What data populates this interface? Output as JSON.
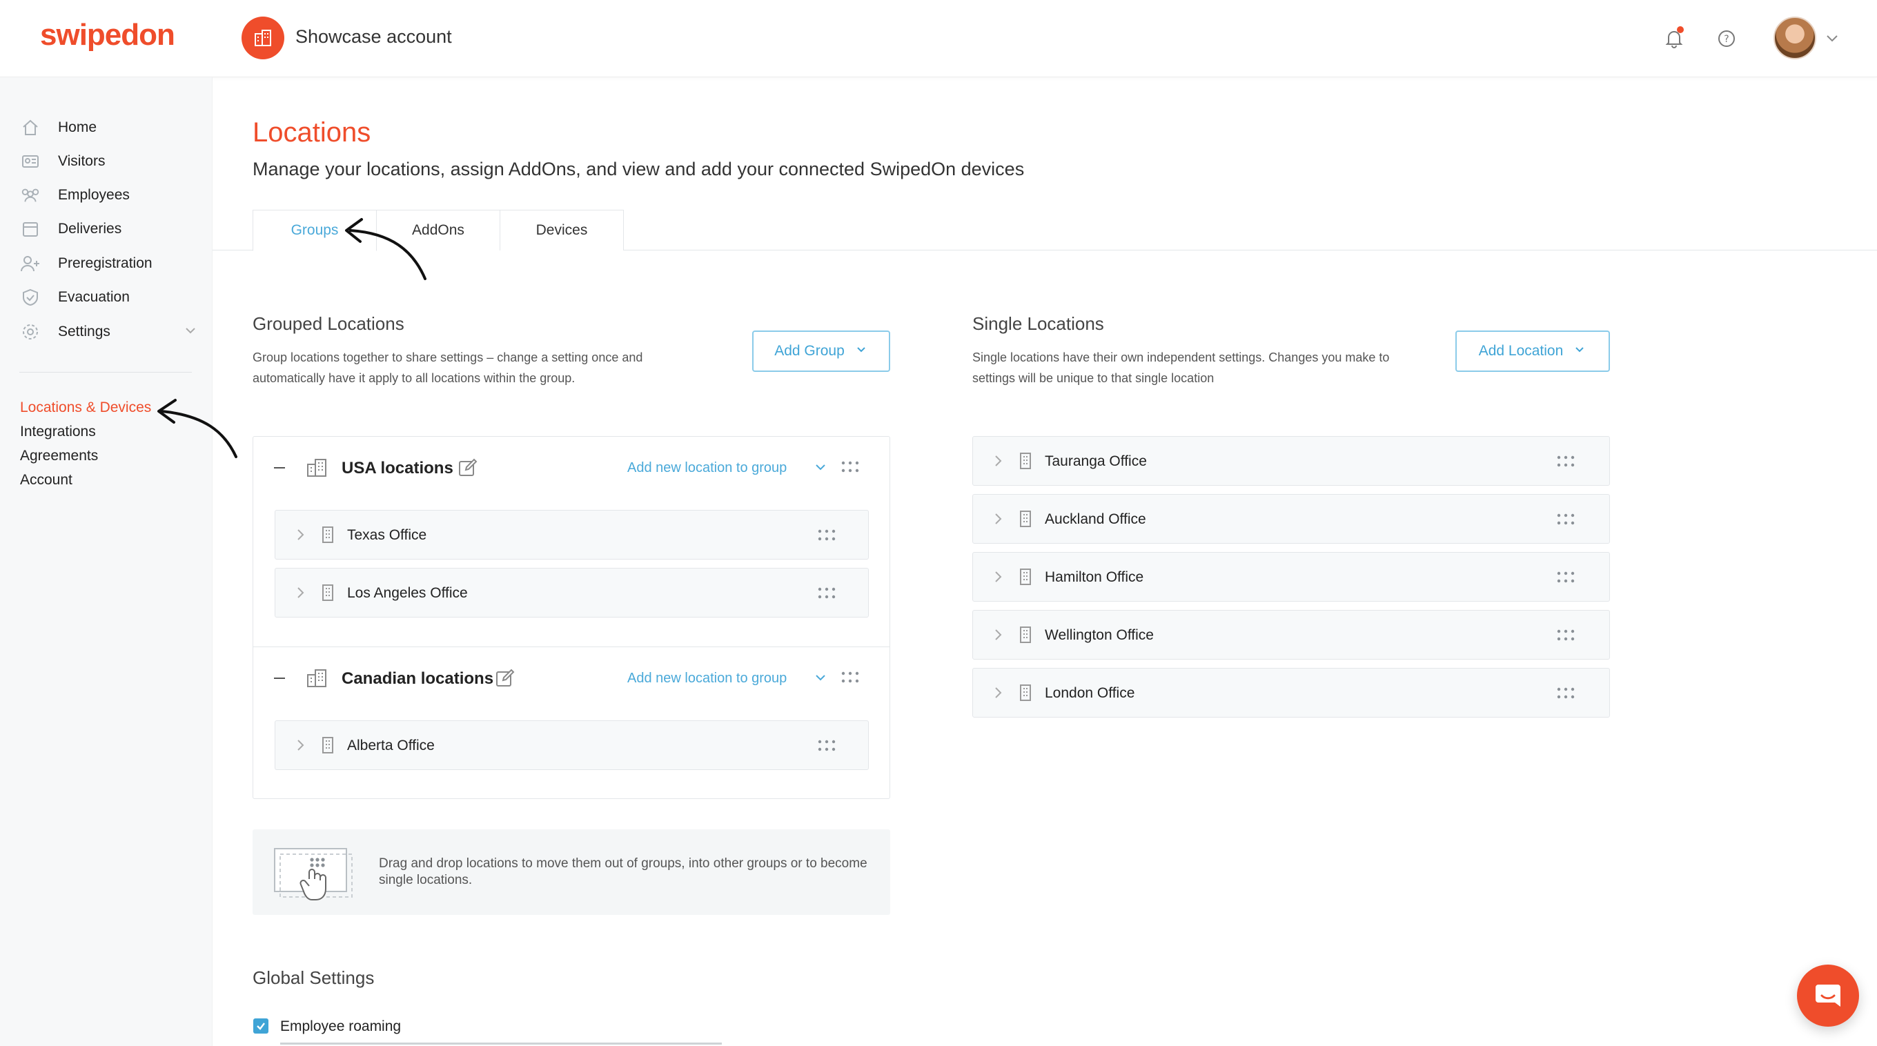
{
  "brand": {
    "logo_text": "swipedon",
    "accent_color": "#ef4d2b",
    "link_color": "#4aa9d9"
  },
  "header": {
    "account_name": "Showcase account",
    "icons": [
      "building-icon",
      "bell-icon",
      "help-icon",
      "avatar",
      "chevron-down-icon"
    ]
  },
  "sidebar": {
    "items": [
      {
        "label": "Home",
        "icon": "home-icon"
      },
      {
        "label": "Visitors",
        "icon": "id-card-icon"
      },
      {
        "label": "Employees",
        "icon": "users-icon"
      },
      {
        "label": "Deliveries",
        "icon": "box-icon"
      },
      {
        "label": "Preregistration",
        "icon": "user-plus-icon"
      },
      {
        "label": "Evacuation",
        "icon": "shield-icon"
      },
      {
        "label": "Settings",
        "icon": "gear-icon"
      }
    ],
    "sub_links": [
      "Locations & Devices",
      "Integrations",
      "Agreements",
      "Account"
    ],
    "active_sub_link": "Locations & Devices"
  },
  "page": {
    "title": "Locations",
    "subtitle": "Manage your locations, assign AddOns, and view and add your connected SwipedOn devices",
    "tabs": [
      "Groups",
      "AddOns",
      "Devices"
    ],
    "active_tab": "Groups"
  },
  "grouped": {
    "title": "Grouped Locations",
    "description_line1": "Group locations together to share settings – change a setting once and",
    "description_line2": "automatically have it apply to all locations within the group.",
    "add_button": "Add Group",
    "add_to_group_label": "Add new location to group",
    "groups": [
      {
        "name": "USA locations",
        "locations": [
          "Texas Office",
          "Los Angeles Office"
        ]
      },
      {
        "name": "Canadian locations",
        "locations": [
          "Alberta Office"
        ]
      }
    ]
  },
  "single": {
    "title": "Single Locations",
    "description_line1": "Single locations have their own independent settings. Changes you make to",
    "description_line2": "settings will be unique to that single location",
    "add_button": "Add Location",
    "locations": [
      "Tauranga Office",
      "Auckland Office",
      "Hamilton Office",
      "Wellington Office",
      "London Office"
    ]
  },
  "hint": {
    "text": "Drag and drop locations to move them out of groups, into other groups or to become single locations."
  },
  "global_settings": {
    "title": "Global Settings",
    "employee_roaming_label": "Employee roaming",
    "employee_roaming_checked": true
  }
}
